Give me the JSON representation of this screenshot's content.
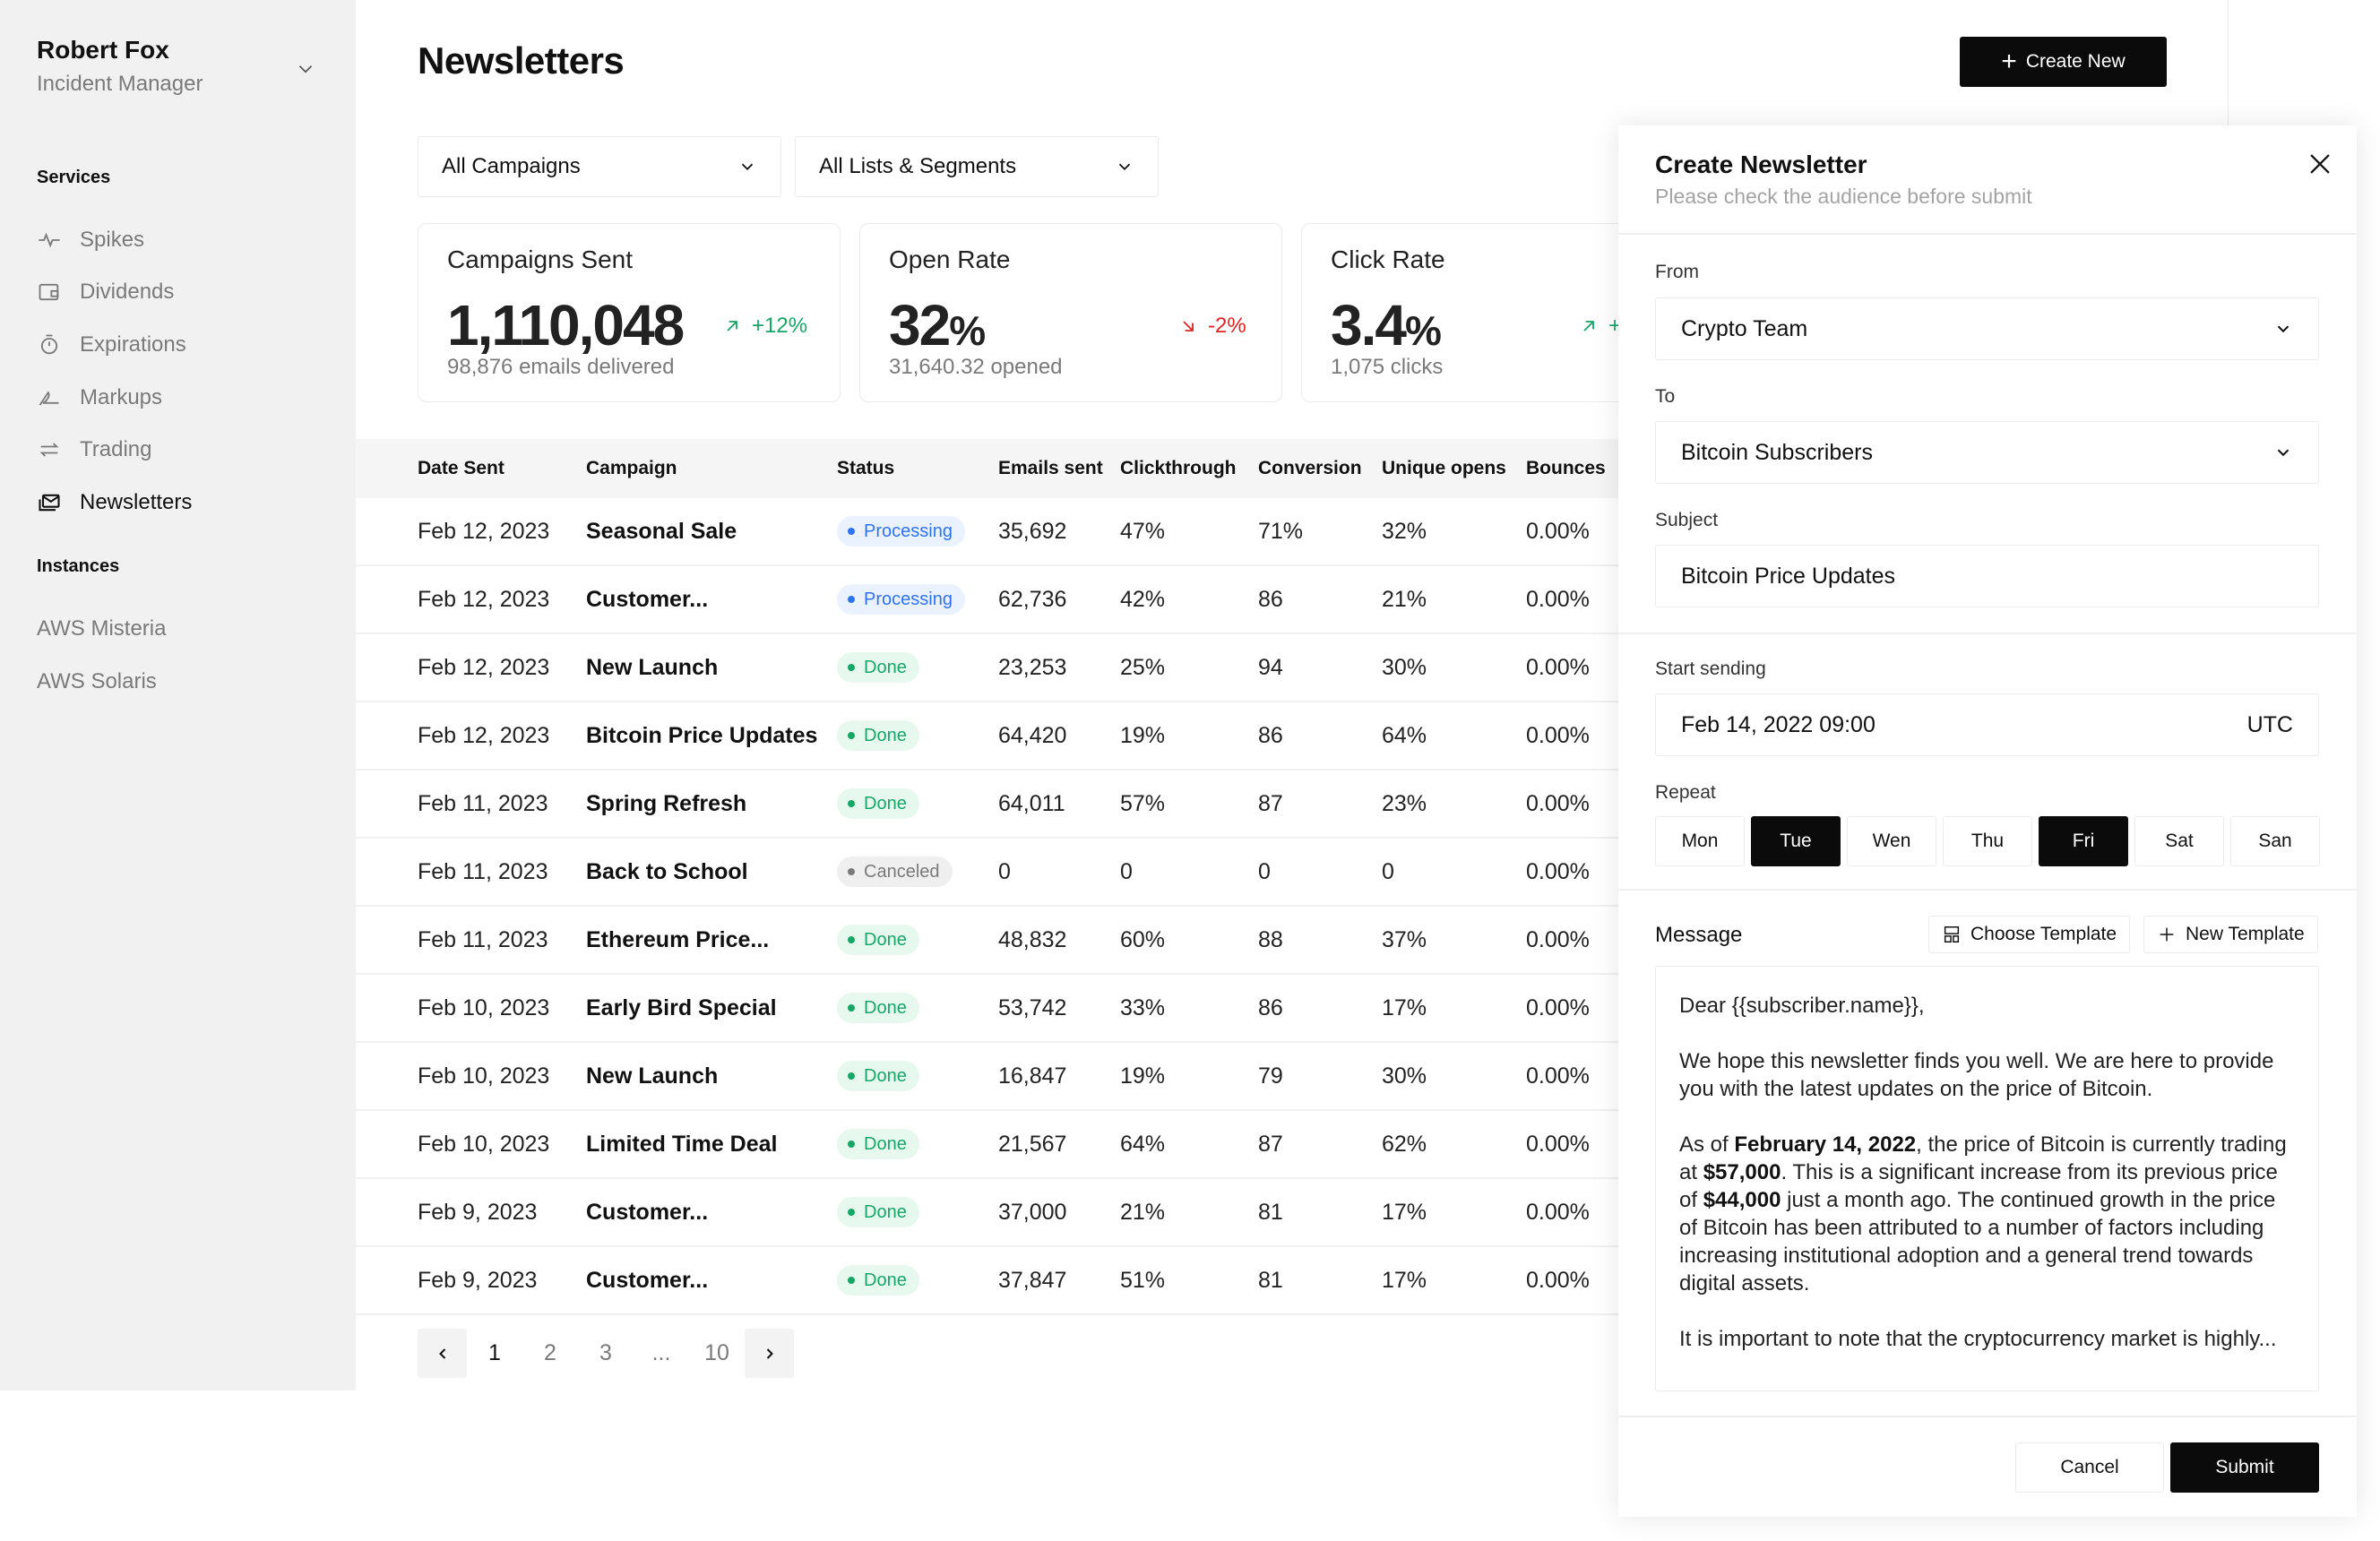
{
  "user": {
    "name": "Robert Fox",
    "role": "Incident Manager"
  },
  "sidebar": {
    "services_title": "Services",
    "services": [
      {
        "label": "Spikes",
        "icon": "activity-icon"
      },
      {
        "label": "Dividends",
        "icon": "wallet-icon"
      },
      {
        "label": "Expirations",
        "icon": "timer-icon"
      },
      {
        "label": "Markups",
        "icon": "signature-icon"
      },
      {
        "label": "Trading",
        "icon": "arrows-exchange-icon"
      },
      {
        "label": "Newsletters",
        "icon": "mail-stack-icon",
        "active": true
      }
    ],
    "instances_title": "Instances",
    "instances": [
      {
        "label": "AWS Misteria"
      },
      {
        "label": "AWS Solaris"
      }
    ]
  },
  "header": {
    "title": "Newsletters",
    "create_label": "Create New"
  },
  "filters": {
    "campaigns": "All Campaigns",
    "lists": "All Lists & Segments"
  },
  "stats": [
    {
      "title": "Campaigns Sent",
      "value": "1,110,048",
      "unit": "",
      "change": "+12%",
      "direction": "up",
      "sub": "98,876 emails delivered"
    },
    {
      "title": "Open Rate",
      "value": "32",
      "unit": "%",
      "change": "-2%",
      "direction": "down",
      "sub": "31,640.32 opened"
    },
    {
      "title": "Click Rate",
      "value": "3.4",
      "unit": "%",
      "change": "+",
      "direction": "up",
      "sub": "1,075 clicks"
    }
  ],
  "table": {
    "columns": [
      "Date Sent",
      "Campaign",
      "Status",
      "Emails sent",
      "Clickthrough",
      "Conversion",
      "Unique opens",
      "Bounces"
    ],
    "rows": [
      [
        "Feb 12, 2023",
        "Seasonal Sale",
        "Processing",
        "35,692",
        "47%",
        "71%",
        "32%",
        "0.00%"
      ],
      [
        "Feb 12, 2023",
        "Customer...",
        "Processing",
        "62,736",
        "42%",
        "86",
        "21%",
        "0.00%"
      ],
      [
        "Feb 12, 2023",
        "New Launch",
        "Done",
        "23,253",
        "25%",
        "94",
        "30%",
        "0.00%"
      ],
      [
        "Feb 12, 2023",
        "Bitcoin Price Updates",
        "Done",
        "64,420",
        "19%",
        "86",
        "64%",
        "0.00%"
      ],
      [
        "Feb 11, 2023",
        "Spring Refresh",
        "Done",
        "64,011",
        "57%",
        "87",
        "23%",
        "0.00%"
      ],
      [
        "Feb 11, 2023",
        "Back to School",
        "Canceled",
        "0",
        "0",
        "0",
        "0",
        "0.00%"
      ],
      [
        "Feb 11, 2023",
        "Ethereum Price...",
        "Done",
        "48,832",
        "60%",
        "88",
        "37%",
        "0.00%"
      ],
      [
        "Feb 10, 2023",
        "Early Bird Special",
        "Done",
        "53,742",
        "33%",
        "86",
        "17%",
        "0.00%"
      ],
      [
        "Feb 10, 2023",
        "New Launch",
        "Done",
        "16,847",
        "19%",
        "79",
        "30%",
        "0.00%"
      ],
      [
        "Feb 10, 2023",
        "Limited Time Deal",
        "Done",
        "21,567",
        "64%",
        "87",
        "62%",
        "0.00%"
      ],
      [
        "Feb 9, 2023",
        "Customer...",
        "Done",
        "37,000",
        "21%",
        "81",
        "17%",
        "0.00%"
      ],
      [
        "Feb 9, 2023",
        "Customer...",
        "Done",
        "37,847",
        "51%",
        "81",
        "17%",
        "0.00%"
      ]
    ]
  },
  "pagination": {
    "pages": [
      "1",
      "2",
      "3",
      "...",
      "10"
    ],
    "current": "1"
  },
  "drawer": {
    "title": "Create Newsletter",
    "subtitle": "Please check the audience before submit",
    "from_label": "From",
    "from_value": "Crypto Team",
    "to_label": "To",
    "to_value": "Bitcoin Subscribers",
    "subject_label": "Subject",
    "subject_value": "Bitcoin Price Updates",
    "start_label": "Start sending",
    "start_value": "Feb 14, 2022 09:00",
    "timezone": "UTC",
    "repeat_label": "Repeat",
    "days": [
      {
        "label": "Mon",
        "selected": false
      },
      {
        "label": "Tue",
        "selected": true
      },
      {
        "label": "Wen",
        "selected": false
      },
      {
        "label": "Thu",
        "selected": false
      },
      {
        "label": "Fri",
        "selected": true
      },
      {
        "label": "Sat",
        "selected": false
      },
      {
        "label": "San",
        "selected": false
      }
    ],
    "message_label": "Message",
    "choose_template": "Choose Template",
    "new_template": "New Template",
    "message": {
      "greeting": "Dear {{subscriber.name}},",
      "p1": "We hope this newsletter finds you well. We are here to provide you with the latest updates on the price of Bitcoin.",
      "p2_a": "As of ",
      "p2_date": "February 14, 2022",
      "p2_b": ", the price of Bitcoin is currently trading at ",
      "p2_price": "$57,000",
      "p2_c": ". This is a significant increase from its previous price of ",
      "p2_prev": "$44,000",
      "p2_d": " just a month ago. The continued growth in the price of Bitcoin has been attributed to a number of factors including increasing institutional adoption and a general trend towards digital assets.",
      "p3": "It is important to note that the cryptocurrency market is highly..."
    },
    "cancel_label": "Cancel",
    "submit_label": "Submit"
  },
  "colors": {
    "accent": "#0b0b0b",
    "up": "#16a767",
    "down": "#e02424",
    "processing": "#2f73f0"
  }
}
